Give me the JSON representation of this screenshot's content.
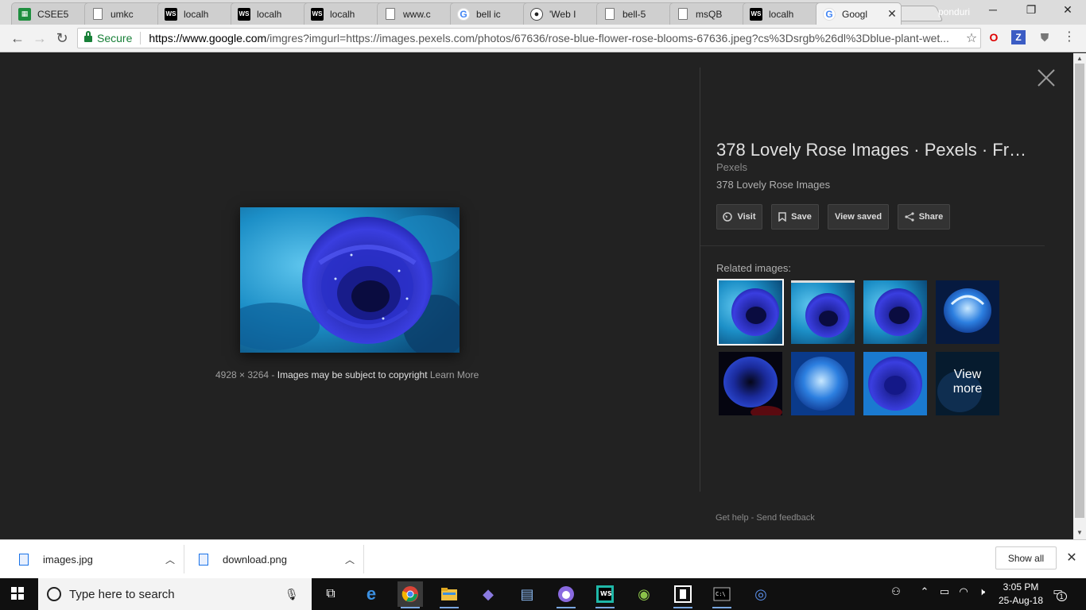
{
  "browser": {
    "tabs": [
      {
        "title": "CSEE5",
        "icon": "sheets-icon"
      },
      {
        "title": "umkc",
        "icon": "doc-icon"
      },
      {
        "title": "localh",
        "icon": "webstorm-icon"
      },
      {
        "title": "localh",
        "icon": "webstorm-icon"
      },
      {
        "title": "localh",
        "icon": "webstorm-icon"
      },
      {
        "title": "www.c",
        "icon": "doc-icon"
      },
      {
        "title": "bell ic",
        "icon": "google-icon"
      },
      {
        "title": "'Web I",
        "icon": "github-icon"
      },
      {
        "title": "bell-5",
        "icon": "doc-icon"
      },
      {
        "title": "msQB",
        "icon": "doc-icon"
      },
      {
        "title": "localh",
        "icon": "webstorm-icon"
      },
      {
        "title": "Googl",
        "icon": "google-icon",
        "active": true
      }
    ],
    "profile_name": "ponduri",
    "secure_label": "Secure",
    "url_host": "https://www.google.com",
    "url_rest": "/imgres?imgurl=https://images.pexels.com/photos/67636/rose-blue-flower-rose-blooms-67636.jpeg?cs%3Dsrgb%26dl%3Dblue-plant-wet..."
  },
  "viewer": {
    "dimensions": "4928 × 3264",
    "copyright_note": "Images may be subject to copyright",
    "learn_more": "Learn More",
    "title": "378 Lovely Rose Images · Pexels · Fr…",
    "source": "Pexels",
    "description": "378 Lovely Rose Images",
    "actions": {
      "visit": "Visit",
      "save": "Save",
      "view_saved": "View saved",
      "share": "Share"
    },
    "related_label": "Related images:",
    "view_more": [
      "View",
      "more"
    ],
    "footer": {
      "get_help": "Get help",
      "separator": "-",
      "send_feedback": "Send feedback"
    }
  },
  "downloads": {
    "items": [
      {
        "name": "images.jpg"
      },
      {
        "name": "download.png"
      }
    ],
    "show_all": "Show all"
  },
  "taskbar": {
    "search_placeholder": "Type here to search",
    "time": "3:05 PM",
    "date": "25-Aug-18",
    "notification_count": "1"
  },
  "colors": {
    "content_bg": "#222222",
    "secure_green": "#188038",
    "rose_blue": "#2a2fc9",
    "background_cyan": "#1aa3d8"
  }
}
